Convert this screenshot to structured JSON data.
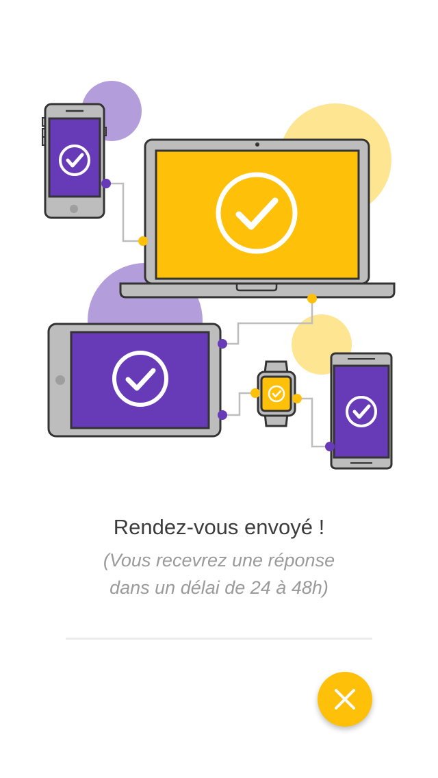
{
  "colors": {
    "accent_yellow": "#fec009",
    "light_yellow": "#fde591",
    "purple": "#673ab7",
    "light_purple": "#b39ddb",
    "device_gray": "#bdbdbd",
    "outline": "#333333"
  },
  "confirmation": {
    "title": "Rendez-vous envoyé !",
    "subtitle_line1": "(Vous recevrez une réponse",
    "subtitle_line2": "dans un délai de 24 à 48h)"
  },
  "close_button": {
    "icon": "close-icon"
  }
}
